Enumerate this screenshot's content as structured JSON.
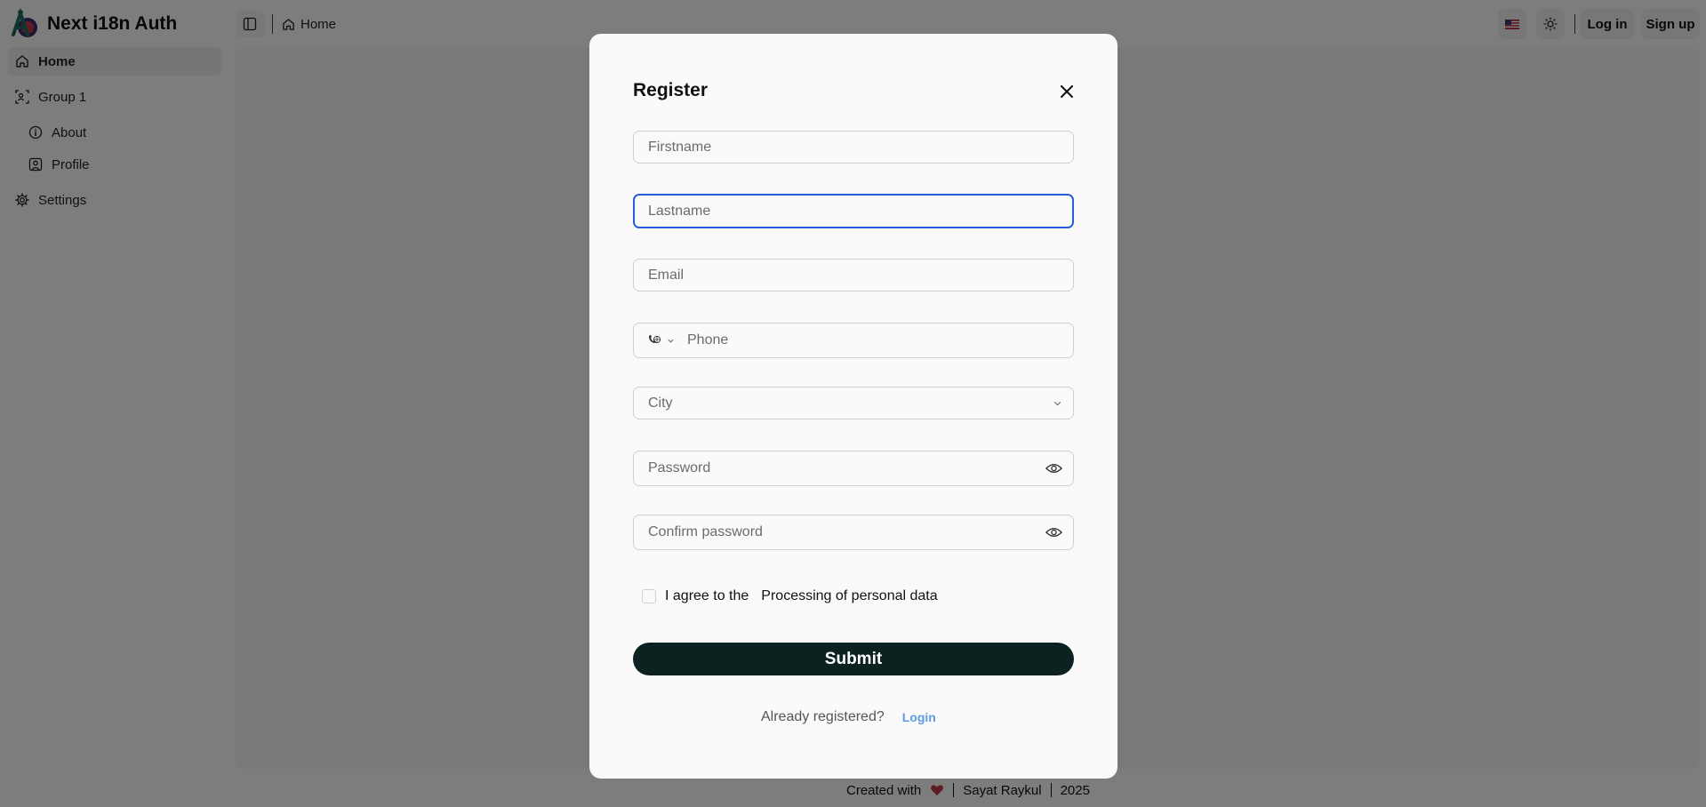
{
  "app": {
    "title": "Next i18n Auth"
  },
  "sidebar": {
    "items": [
      {
        "label": "Home",
        "icon": "home-icon"
      },
      {
        "label": "Group 1",
        "icon": "group-icon"
      },
      {
        "label": "About",
        "icon": "info-icon"
      },
      {
        "label": "Profile",
        "icon": "profile-icon"
      },
      {
        "label": "Settings",
        "icon": "gear-icon"
      }
    ]
  },
  "header": {
    "breadcrumb": "Home",
    "login_label": "Log in",
    "signup_label": "Sign up",
    "flag_icon": "us-flag-icon",
    "theme_icon": "sun-icon"
  },
  "footer": {
    "created": "Created with",
    "author": "Sayat Raykul",
    "year": "2025"
  },
  "modal": {
    "title": "Register",
    "fields": {
      "firstname": "Firstname",
      "lastname": "Lastname",
      "email": "Email",
      "phone": "Phone",
      "city": "City",
      "password": "Password",
      "confirm_password": "Confirm password"
    },
    "agree_prefix": "I agree to the",
    "agree_link": "Processing of personal data",
    "submit_label": "Submit",
    "already_text": "Already registered?",
    "login_link": "Login"
  },
  "colors": {
    "accent": "#2a5bd7",
    "submit_bg": "#0b2221",
    "link": "#5e9be0",
    "heart": "#c0364a"
  }
}
